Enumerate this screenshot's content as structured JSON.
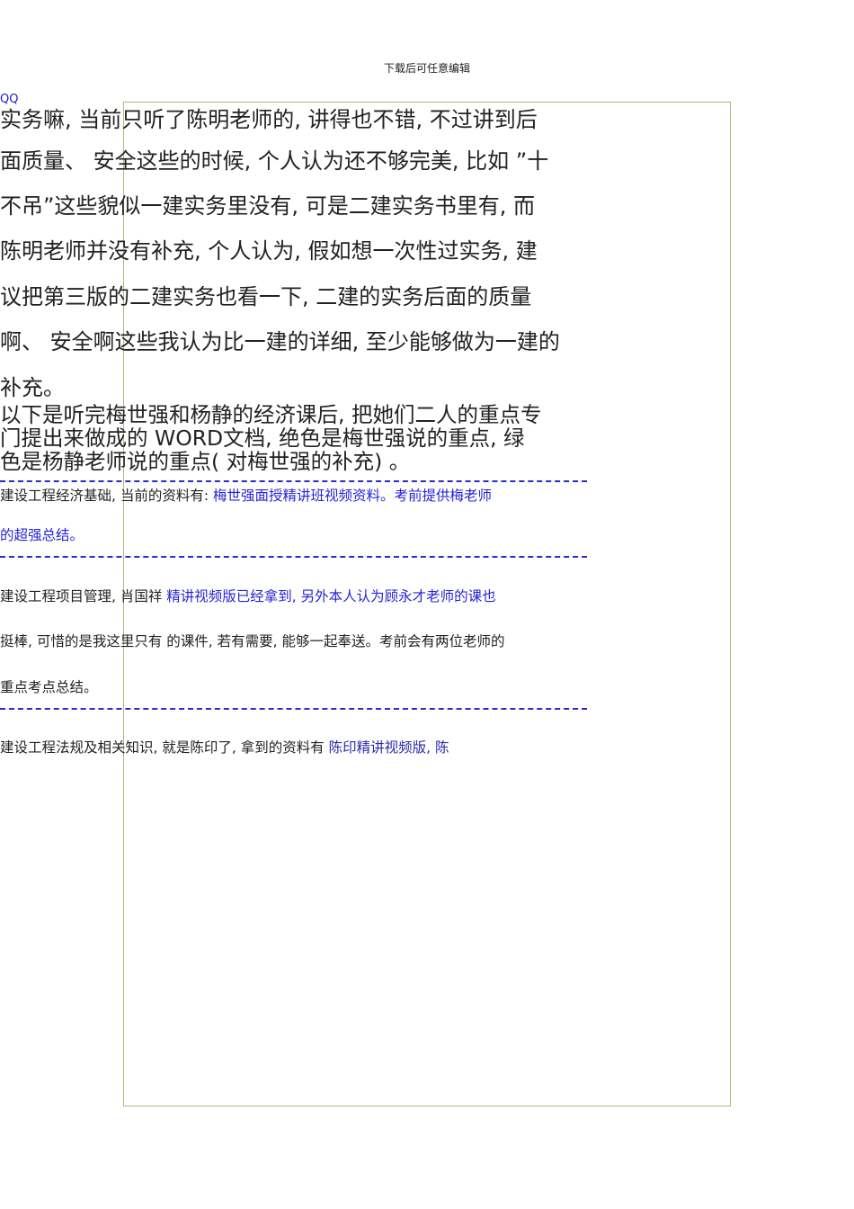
{
  "header": "下载后可任意编辑",
  "qq": "QQ",
  "para1": [
    "实务嘛, 当前只听了陈明老师的, 讲得也不错, 不过讲到后",
    "面质量、 安全这些的时候, 个人认为还不够完美, 比如 ”十",
    "不吊”这些貌似一建实务里没有, 可是二建实务书里有, 而",
    "陈明老师并没有补充, 个人认为, 假如想一次性过实务, 建",
    "议把第三版的二建实务也看一下, 二建的实务后面的质量",
    "啊、 安全啊这些我认为比一建的详细, 至少能够做为一建的",
    "补充。"
  ],
  "para2": [
    "以下是听完梅世强和杨静的经济课后, 把她们二人的重点专",
    "门提出来做成的 WORD文档, 绝色是梅世强说的重点, 绿",
    "色是杨静老师说的重点( 对梅世强的补充) 。"
  ],
  "sec1": {
    "a": "建设工程经济基础, 当前的资料有: ",
    "b": "梅世强面授精讲班视频资料。考前提供梅老师",
    "c": "的超强总结。"
  },
  "sec2": {
    "a": "建设工程项目管理, 肖国祥  ",
    "b": "精讲视频版已经拿到, 另外本人认为顾永才老师的课也",
    "c": "挺棒, 可惜的是我这里只有  的课件, 若有需要, 能够一起奉送。考前会有两位老师的",
    "d": "重点考点总结。"
  },
  "sec3": {
    "a": "建设工程法规及相关知识, 就是陈印了, 拿到的资料有  ",
    "b": "陈印精讲视频版, 陈"
  }
}
